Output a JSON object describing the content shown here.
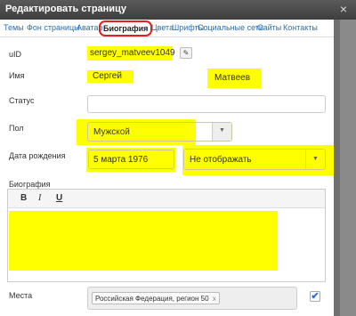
{
  "window": {
    "title": "Редактировать страницу",
    "close_glyph": "×"
  },
  "tabs": [
    {
      "label": "Темы"
    },
    {
      "label": "Фон страницы"
    },
    {
      "label": "Аватар"
    },
    {
      "label": "Биография",
      "active": true
    },
    {
      "label": "Цвета"
    },
    {
      "label": "Шрифты"
    },
    {
      "label": "Социальные сети"
    },
    {
      "label": "Сайты"
    },
    {
      "label": "Контакты"
    }
  ],
  "form": {
    "uid": {
      "label": "uID",
      "value": "sergey_matveev1049",
      "edit_icon": "pencil-icon"
    },
    "name": {
      "label": "Имя",
      "first": "Сергей",
      "last": "Матвеев"
    },
    "status": {
      "label": "Статус",
      "value": ""
    },
    "gender": {
      "label": "Пол",
      "value": "Мужской"
    },
    "birthdate": {
      "label": "Дата рождения",
      "date": "5 марта 1976",
      "visibility": "Не отображать"
    },
    "bio": {
      "label": "Биография",
      "toolbar": {
        "bold": "B",
        "italic": "I",
        "underline": "U"
      },
      "value": ""
    },
    "places": {
      "label": "Места",
      "chip": "Российская Федерация, регион 50",
      "chip_remove": "x",
      "checked": true,
      "check_glyph": "✔"
    }
  },
  "colors": {
    "highlight": "#ffff00",
    "link": "#2a6fb6",
    "active_tab_border": "#e02020"
  }
}
